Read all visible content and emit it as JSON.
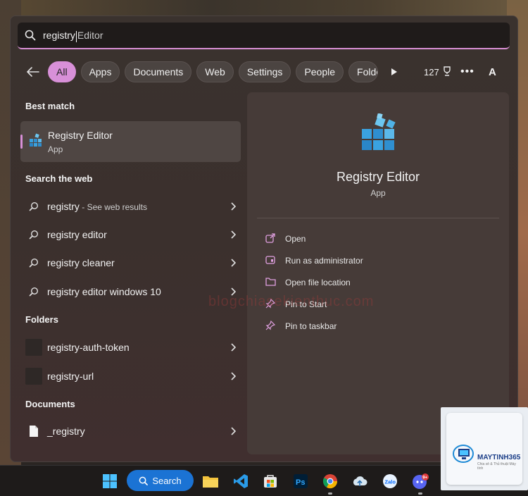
{
  "search": {
    "query": "registry",
    "completion": "Editor"
  },
  "filters": {
    "chips": [
      "All",
      "Apps",
      "Documents",
      "Web",
      "Settings",
      "People",
      "Folde"
    ],
    "points": "127"
  },
  "avatar_initial": "A",
  "best_match": {
    "title": "Best match",
    "name": "Registry Editor",
    "type": "App"
  },
  "web": {
    "title": "Search the web",
    "items": [
      {
        "text": "registry",
        "sub": " - See web results"
      },
      {
        "text": "registry editor",
        "sub": ""
      },
      {
        "text": "registry cleaner",
        "sub": ""
      },
      {
        "text": "registry editor windows 10",
        "sub": ""
      }
    ]
  },
  "folders": {
    "title": "Folders",
    "items": [
      "registry-auth-token",
      "registry-url"
    ]
  },
  "documents": {
    "title": "Documents",
    "items": [
      "_registry"
    ]
  },
  "detail": {
    "name": "Registry Editor",
    "type": "App",
    "actions": [
      "Open",
      "Run as administrator",
      "Open file location",
      "Pin to Start",
      "Pin to taskbar"
    ]
  },
  "watermark": "blogchiasekienthuc.com",
  "taskbar": {
    "search_label": "Search",
    "badge": "9+"
  },
  "logo": {
    "brand": "MAYTINH365",
    "tagline": "Chia sẻ & Thủ thuật Máy tính"
  },
  "colors": {
    "accent": "#d890d8",
    "taskbar_search": "#1b73d4"
  }
}
